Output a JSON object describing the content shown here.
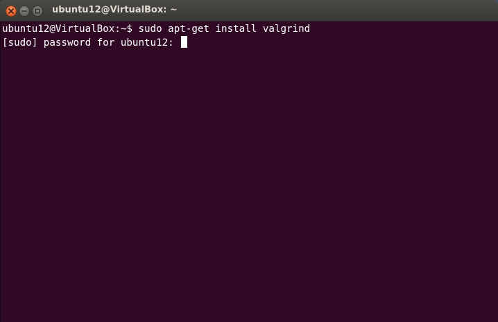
{
  "window": {
    "title": "ubuntu12@VirtualBox: ~"
  },
  "controls": {
    "close": "close-icon",
    "minimize": "minimize-icon",
    "maximize": "maximize-icon"
  },
  "terminal": {
    "lines": [
      "ubuntu12@VirtualBox:~$ sudo apt-get install valgrind",
      "[sudo] password for ubuntu12: "
    ],
    "background": "#300a24",
    "foreground": "#ffffff"
  }
}
